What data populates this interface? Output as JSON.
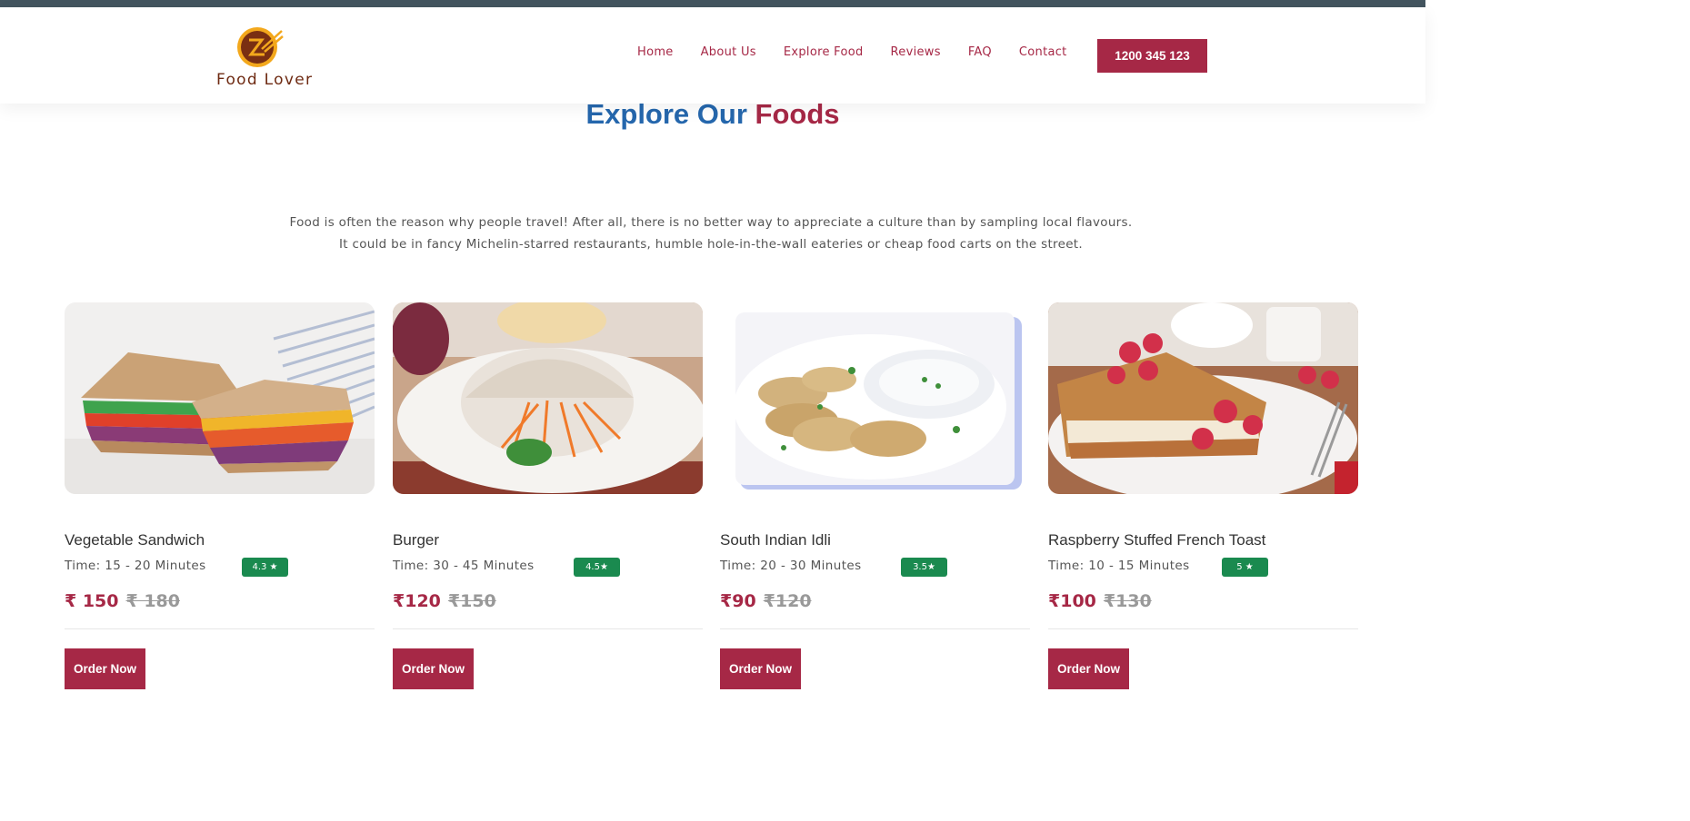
{
  "brand": {
    "name": "Food Lover",
    "logo_icon": "chopsticks-bowl-logo"
  },
  "nav": {
    "items": [
      "Home",
      "About Us",
      "Explore Food",
      "Reviews",
      "FAQ",
      "Contact"
    ],
    "phone": "1200 345 123"
  },
  "section": {
    "title_part1": "Explore Our",
    "title_part2": "Foods",
    "description_line1": "Food is often the reason why people travel! After all, there is no better way to appreciate a culture than by sampling local flavours.",
    "description_line2": "It could be in fancy Michelin-starred restaurants, humble hole-in-the-wall eateries or cheap food carts on the street."
  },
  "foods": [
    {
      "name": "Vegetable Sandwich",
      "time": "Time: 15 - 20 Minutes",
      "rating": "4.3 ★",
      "price": "₹ 150",
      "old_price": "₹ 180",
      "order_label": "Order Now",
      "image": "sandwich-photo"
    },
    {
      "name": "Burger",
      "time": "Time: 30 - 45 Minutes",
      "rating": "4.5★",
      "price": "₹120",
      "old_price": "₹150",
      "order_label": "Order Now",
      "image": "burger-photo"
    },
    {
      "name": "South Indian Idli",
      "time": "Time: 20 - 30 Minutes",
      "rating": "3.5★",
      "price": "₹90",
      "old_price": "₹120",
      "order_label": "Order Now",
      "image": "idli-photo"
    },
    {
      "name": "Raspberry Stuffed French Toast",
      "time": "Time: 10 - 15 Minutes",
      "rating": "5 ★",
      "price": "₹100",
      "old_price": "₹130",
      "order_label": "Order Now",
      "image": "french-toast-photo"
    }
  ],
  "colors": {
    "accent": "#a62846",
    "blue": "#2567ad",
    "rating_green": "#1a8a4f",
    "topbar": "#43555f"
  }
}
